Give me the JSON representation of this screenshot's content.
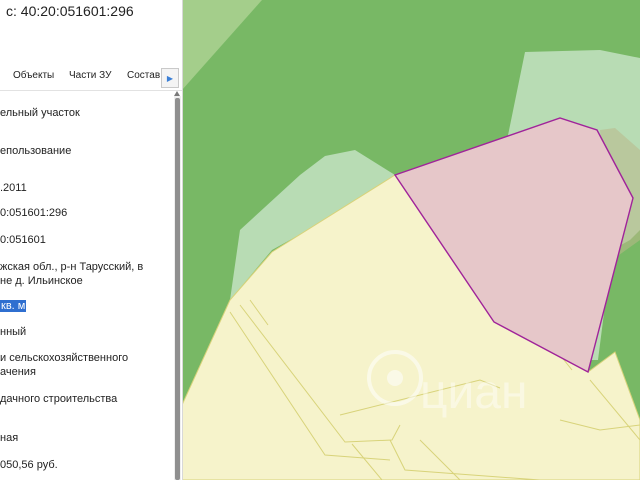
{
  "header": {
    "title": "с: 40:20:051601:296"
  },
  "tabs": [
    {
      "label": "Объекты"
    },
    {
      "label": "Части ЗУ"
    },
    {
      "label": "Состав"
    }
  ],
  "tab_next_icon": "chevron-right-icon",
  "fields": [
    {
      "text": "ельный участок"
    },
    {
      "text": "епользование"
    },
    {
      "text": ".2011"
    },
    {
      "text": "0:051601:296"
    },
    {
      "text": "0:051601"
    },
    {
      "text": "жская обл., р-н Тарусский, в\nне д. Ильинское"
    },
    {
      "text": "кв. м"
    },
    {
      "text": "нный"
    },
    {
      "text": "и сельскохозяйственного\nачения"
    },
    {
      "text": "дачного строительства"
    },
    {
      "text": "ная"
    },
    {
      "text": "050,56 руб."
    }
  ],
  "watermark": {
    "text": "циан",
    "icon": "cian-logo-icon",
    "subtext": ""
  },
  "colors": {
    "forest": "#78b865",
    "forest_dark": "#5f9e4c",
    "meadow": "#b8dcb4",
    "plot_zone": "#f6f3cb",
    "plot_line": "#d8d37a",
    "parcel_fill": "#e6c7c9",
    "parcel_border": "#a0239a",
    "selection": "#2f6fd0"
  }
}
